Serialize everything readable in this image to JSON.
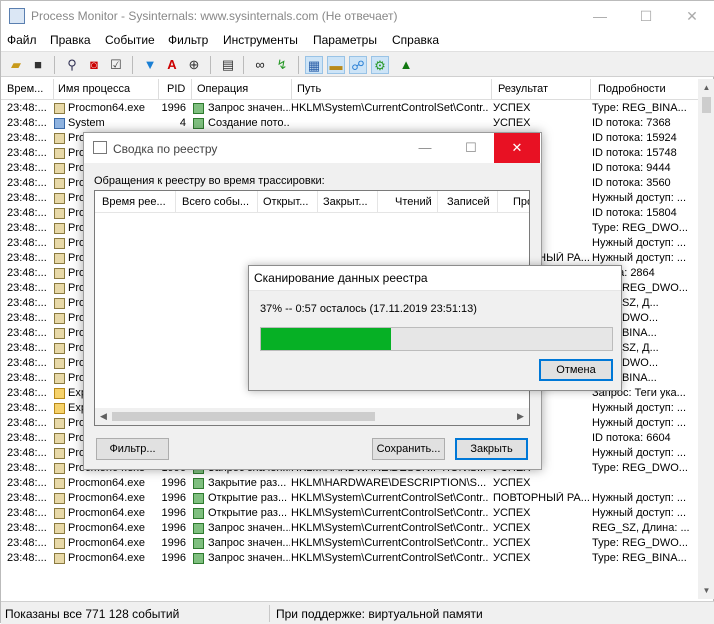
{
  "window": {
    "title": "Process Monitor - Sysinternals: www.sysinternals.com (Не отвечает)",
    "minimize": "—",
    "maximize": "☐",
    "close": "✕"
  },
  "menu": [
    "Файл",
    "Правка",
    "Событие",
    "Фильтр",
    "Инструменты",
    "Параметры",
    "Справка"
  ],
  "toolbar_icons": [
    "open-icon",
    "save-icon",
    "magnify-icon",
    "capture-icon",
    "autoscroll-icon",
    "clear-icon",
    "filter-icon",
    "highlight-icon",
    "target-icon",
    "tree-icon",
    "find-icon",
    "jump-icon",
    "registry-activity-icon",
    "file-activity-icon",
    "network-activity-icon",
    "process-activity-icon",
    "profiling-icon"
  ],
  "grid": {
    "columns": [
      "Врем...",
      "Имя процесса",
      "PID",
      "Операция",
      "Путь",
      "Результат",
      "Подробности"
    ],
    "rows": [
      [
        "23:48:...",
        "Procmon64.exe",
        "1996",
        "Запрос значен...",
        "HKLM\\System\\CurrentControlSet\\Contr...",
        "УСПЕХ",
        "Type: REG_BINA..."
      ],
      [
        "23:48:...",
        "System",
        "4",
        "Создание пото...",
        "",
        "УСПЕХ",
        "ID потока: 7368"
      ],
      [
        "23:48:...",
        "Proc",
        "",
        "",
        "",
        "",
        "ID потока: 15924"
      ],
      [
        "23:48:...",
        "Proc",
        "",
        "",
        "",
        "",
        "ID потока: 15748"
      ],
      [
        "23:48:...",
        "Proc",
        "",
        "",
        "",
        "",
        "ID потока: 9444"
      ],
      [
        "23:48:...",
        "Proc",
        "",
        "",
        "",
        "",
        "ID потока: 3560"
      ],
      [
        "23:48:...",
        "Proc",
        "",
        "",
        "",
        "",
        "Нужный доступ: ..."
      ],
      [
        "23:48:...",
        "Proc",
        "",
        "",
        "",
        "",
        "ID потока: 15804"
      ],
      [
        "23:48:...",
        "Proc",
        "",
        "",
        "",
        "",
        "Type: REG_DWO..."
      ],
      [
        "23:48:...",
        "Proc",
        "",
        "",
        "",
        "",
        "Нужный доступ: ..."
      ],
      [
        "23:48:...",
        "Proc",
        "",
        "",
        "",
        "ПОВТОРНЫЙ РА...",
        "Нужный доступ: ..."
      ],
      [
        "23:48:...",
        "Proc",
        "",
        "",
        "",
        "",
        "Длина: 2864"
      ],
      [
        "23:48:...",
        "Proc",
        "",
        "",
        "",
        "",
        "Type: REG_DWO..."
      ],
      [
        "23:48:...",
        "Proc",
        "",
        "",
        "",
        "",
        "REG_SZ, Д..."
      ],
      [
        "23:48:...",
        "Proc",
        "",
        "",
        "",
        "",
        "REG_DWO..."
      ],
      [
        "23:48:...",
        "Proc",
        "",
        "",
        "",
        "",
        "REG_BINA..."
      ],
      [
        "23:48:...",
        "Proc",
        "",
        "",
        "",
        "",
        "REG_SZ, Д..."
      ],
      [
        "23:48:...",
        "Proc",
        "",
        "",
        "",
        "",
        "REG_DWO..."
      ],
      [
        "23:48:...",
        "Proc",
        "",
        "",
        "",
        "",
        "REG_BINA..."
      ],
      [
        "23:48:...",
        "Expl",
        "",
        "",
        "",
        "",
        "Запрос: Теги ука..."
      ],
      [
        "23:48:...",
        "Expl",
        "",
        "",
        "",
        "",
        "Нужный доступ: ..."
      ],
      [
        "23:48:...",
        "Proc",
        "",
        "",
        "",
        "",
        "Нужный доступ: ..."
      ],
      [
        "23:48:...",
        "Proc",
        "",
        "",
        "",
        "",
        "ID потока: 6604"
      ],
      [
        "23:48:...",
        "Procmon64.exe",
        "1996",
        "Открытие разд...",
        "HKLM\\HARDWARE\\DESCRIPTION\\S...",
        "УСПЕХ",
        "Нужный доступ: ..."
      ],
      [
        "23:48:...",
        "Procmon64.exe",
        "1996",
        "Запрос значен...",
        "HKLM\\HARDWARE\\DESCRIPTION\\S...",
        "УСПЕХ",
        "Type: REG_DWO..."
      ],
      [
        "23:48:...",
        "Procmon64.exe",
        "1996",
        "Закрытие раз...",
        "HKLM\\HARDWARE\\DESCRIPTION\\S...",
        "УСПЕХ",
        ""
      ],
      [
        "23:48:...",
        "Procmon64.exe",
        "1996",
        "Открытие раз...",
        "HKLM\\System\\CurrentControlSet\\Contr...",
        "ПОВТОРНЫЙ РА...",
        "Нужный доступ: ..."
      ],
      [
        "23:48:...",
        "Procmon64.exe",
        "1996",
        "Открытие раз...",
        "HKLM\\System\\CurrentControlSet\\Contr...",
        "УСПЕХ",
        "Нужный доступ: ..."
      ],
      [
        "23:48:...",
        "Procmon64.exe",
        "1996",
        "Запрос значен...",
        "HKLM\\System\\CurrentControlSet\\Contr...",
        "УСПЕХ",
        "REG_SZ, Длина: ..."
      ],
      [
        "23:48:...",
        "Procmon64.exe",
        "1996",
        "Запрос значен...",
        "HKLM\\System\\CurrentControlSet\\Contr...",
        "УСПЕХ",
        "Type: REG_DWO..."
      ],
      [
        "23:48:...",
        "Procmon64.exe",
        "1996",
        "Запрос значен...",
        "HKLM\\System\\CurrentControlSet\\Contr...",
        "УСПЕХ",
        "Type: REG_BINA..."
      ]
    ]
  },
  "status": {
    "events": "Показаны все 771 128 событий",
    "backing": "При поддержке: виртуальной памяти"
  },
  "dialog": {
    "title": "Сводка по реестру",
    "label": "Обращения к реестру во время трассировки:",
    "columns": [
      "Время рее...",
      "Всего собы...",
      "Открыт...",
      "Закрыт...",
      "Чтений",
      "Записей",
      "Про"
    ],
    "filter": "Фильтр...",
    "save": "Сохранить...",
    "close": "Закрыть"
  },
  "progress": {
    "title": "Сканирование данных реестра",
    "text": "37% -- 0:57 осталось (17.11.2019 23:51:13)",
    "percent": 37,
    "cancel": "Отмена",
    "color": "#06b025"
  }
}
